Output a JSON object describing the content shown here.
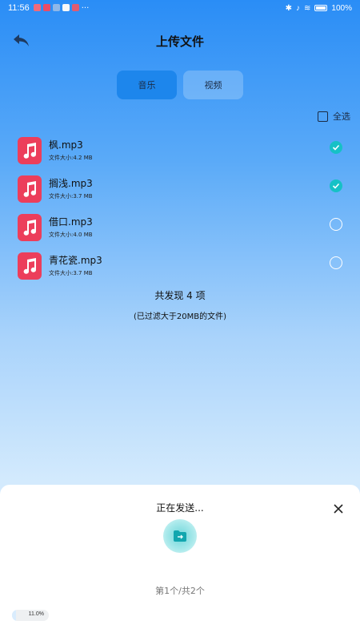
{
  "status_bar": {
    "time": "11:56",
    "battery": "100%"
  },
  "header": {
    "title": "上传文件",
    "back_icon": "back-arrow-icon"
  },
  "tabs": [
    {
      "label": "音乐",
      "active": true
    },
    {
      "label": "视频",
      "active": false
    }
  ],
  "select_all": {
    "label": "全选",
    "checked": false
  },
  "files": [
    {
      "name": "枫.mp3",
      "size": "文件大小:4.2 MB",
      "checked": true
    },
    {
      "name": "搁浅.mp3",
      "size": "文件大小:3.7 MB",
      "checked": true
    },
    {
      "name": "借口.mp3",
      "size": "文件大小:4.0 MB",
      "checked": false
    },
    {
      "name": "青花瓷.mp3",
      "size": "文件大小:3.7 MB",
      "checked": false
    }
  ],
  "summary": {
    "count": "共发现 4 项",
    "filter_note": "(已过滤大于20MB的文件)"
  },
  "sheet": {
    "title": "正在发送...",
    "progress_text": "第1个/共2个",
    "progress_label": "11.0%",
    "progress_value": 0.11
  },
  "colors": {
    "accent": "#1d86ec",
    "check": "#16c1c6",
    "music_icon": "#ec3e5b"
  }
}
